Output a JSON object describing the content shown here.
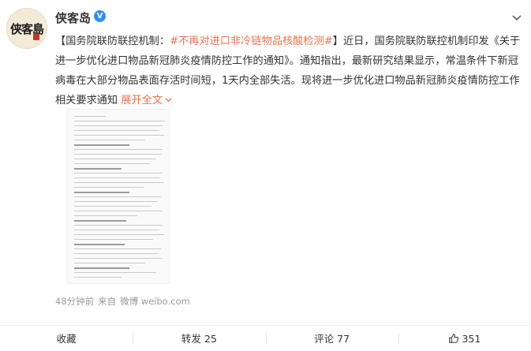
{
  "post": {
    "author": "侠客岛",
    "avatar_text": "侠客島",
    "verified_badge": "V",
    "text": {
      "open_bracket": "【",
      "prefix": "国务院联防联控机制：",
      "hashtag": "#不再对进口非冷链物品核酸检测#",
      "body": "】近日，国务院联防联控机制印发《关于进一步优化进口物品新冠肺炎疫情防控工作的通知》。通知指出，最新研究结果显示，常温条件下新冠病毒在大部分物品表面存活时间短，1天内全部失活。现将进一步优化进口物品新冠肺炎疫情防控工作相关要求通知",
      "expand_label": "展开全文",
      "expand_icon": "chevron-down"
    },
    "meta": {
      "time": "48分钟前",
      "source_prefix": "来自",
      "source": "微博 weibo.com"
    }
  },
  "actions": {
    "favorite": "收藏",
    "repost": "转发 25",
    "comment": "评论 77",
    "like": "351"
  },
  "colors": {
    "accent": "#eb7350",
    "verified": "#2b8ff0",
    "text": "#333333",
    "muted": "#999999"
  }
}
